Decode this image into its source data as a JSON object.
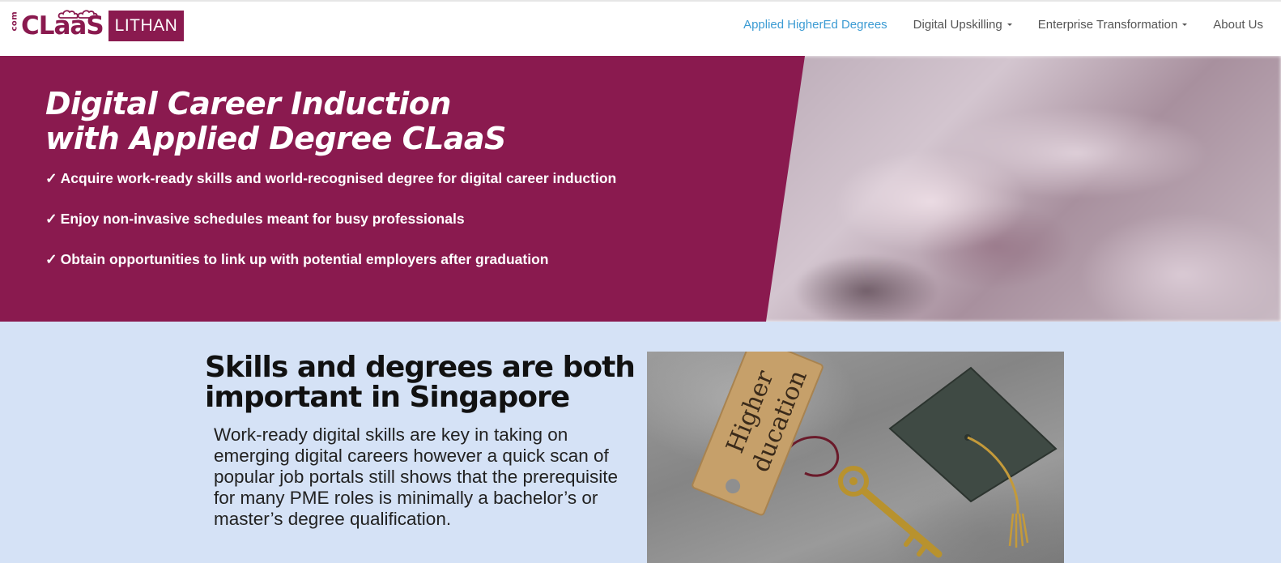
{
  "brand": {
    "com": "com",
    "claas": "CLaaS",
    "lithan": "LITHAN",
    "primary_color": "#8a1a4f",
    "link_color": "#3b9bd3",
    "section_bg": "#d5e2f6"
  },
  "nav": {
    "items": [
      {
        "label": "Applied HigherEd Degrees",
        "active": true,
        "dropdown": false
      },
      {
        "label": "Digital Upskilling",
        "active": false,
        "dropdown": true
      },
      {
        "label": "Enterprise Transformation",
        "active": false,
        "dropdown": true
      },
      {
        "label": "About Us",
        "active": false,
        "dropdown": false
      }
    ]
  },
  "hero": {
    "title_line1": "Digital Career Induction",
    "title_line2": "with Applied Degree CLaaS",
    "check": "✓",
    "bullets": [
      "Acquire work-ready skills and world-recognised degree for digital career induction",
      "Enjoy non-invasive schedules meant for busy professionals",
      "Obtain opportunities to link up with potential employers after graduation"
    ]
  },
  "section": {
    "title_line1": "Skills and degrees are both",
    "title_line2": "important in Singapore",
    "body": "Work-ready digital skills are key in taking on emerging digital careers however a quick scan of popular job portals still shows that the prerequisite for many PME roles is minimally a bachelor’s or master’s degree qualification.",
    "image_tag_text": "Higher education"
  }
}
